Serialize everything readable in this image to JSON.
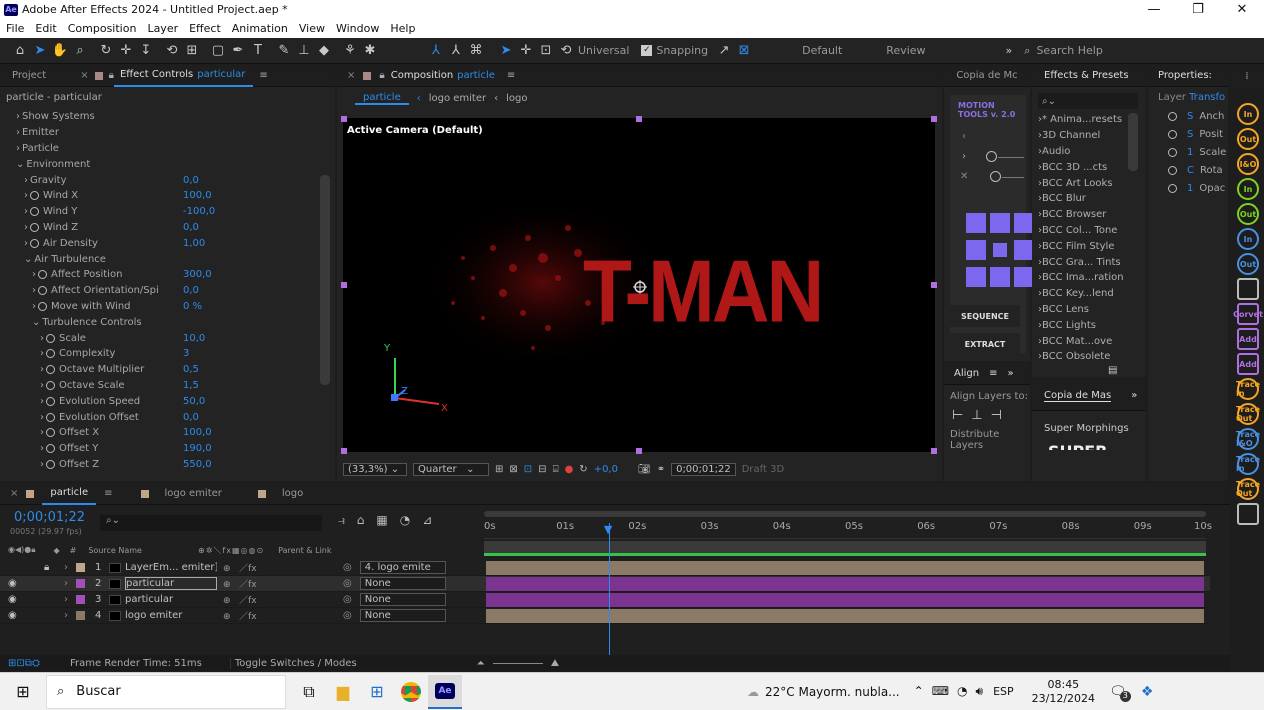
{
  "window": {
    "title": "Adobe After Effects 2024 - Untitled Project.aep *",
    "app_badge": "Ae",
    "controls": [
      "—",
      "❐",
      "✕"
    ]
  },
  "menu": [
    "File",
    "Edit",
    "Composition",
    "Layer",
    "Effect",
    "Animation",
    "View",
    "Window",
    "Help"
  ],
  "toolbar": {
    "universal_label": "Universal",
    "snapping_label": "Snapping",
    "workspaces": [
      "Default",
      "Review"
    ],
    "search_placeholder": "Search Help"
  },
  "left_panel": {
    "tabs": {
      "project": "Project",
      "effect_controls": "Effect Controls",
      "effect_controls_layer": "particular"
    },
    "layer_header": "particle - particular",
    "properties": [
      {
        "label": "Show Systems",
        "indent": 1,
        "type": "collapsed"
      },
      {
        "label": "Emitter",
        "indent": 1,
        "type": "collapsed"
      },
      {
        "label": "Particle",
        "indent": 1,
        "type": "collapsed"
      },
      {
        "label": "Environment",
        "indent": 1,
        "type": "expanded"
      },
      {
        "label": "Gravity",
        "indent": 2,
        "type": "collapsed",
        "value": "0,0"
      },
      {
        "label": "Wind X",
        "indent": 2,
        "type": "stopwatch",
        "value": "100,0"
      },
      {
        "label": "Wind Y",
        "indent": 2,
        "type": "stopwatch",
        "value": "-100,0"
      },
      {
        "label": "Wind Z",
        "indent": 2,
        "type": "stopwatch",
        "value": "0,0"
      },
      {
        "label": "Air Density",
        "indent": 2,
        "type": "stopwatch",
        "value": "1,00"
      },
      {
        "label": "Air Turbulence",
        "indent": 2,
        "type": "expanded"
      },
      {
        "label": "Affect Position",
        "indent": 3,
        "type": "stopwatch",
        "value": "300,0"
      },
      {
        "label": "Affect Orientation/Spi",
        "indent": 3,
        "type": "stopwatch",
        "value": "0,0"
      },
      {
        "label": "Move with Wind",
        "indent": 3,
        "type": "stopwatch",
        "value": "0 %"
      },
      {
        "label": "Turbulence Controls",
        "indent": 3,
        "type": "expanded"
      },
      {
        "label": "Scale",
        "indent": 4,
        "type": "stopwatch",
        "value": "10,0"
      },
      {
        "label": "Complexity",
        "indent": 4,
        "type": "stopwatch",
        "value": "3"
      },
      {
        "label": "Octave Multiplier",
        "indent": 4,
        "type": "stopwatch",
        "value": "0,5"
      },
      {
        "label": "Octave Scale",
        "indent": 4,
        "type": "stopwatch",
        "value": "1,5"
      },
      {
        "label": "Evolution Speed",
        "indent": 4,
        "type": "stopwatch",
        "value": "50,0"
      },
      {
        "label": "Evolution Offset",
        "indent": 4,
        "type": "stopwatch",
        "value": "0,0"
      },
      {
        "label": "Offset X",
        "indent": 4,
        "type": "stopwatch",
        "value": "100,0"
      },
      {
        "label": "Offset Y",
        "indent": 4,
        "type": "stopwatch",
        "value": "190,0"
      },
      {
        "label": "Offset Z",
        "indent": 4,
        "type": "stopwatch",
        "value": "550,0"
      }
    ]
  },
  "composition": {
    "tab_label": "Composition",
    "tab_comp": "particle",
    "breadcrumbs": [
      "particle",
      "logo emiter",
      "logo"
    ],
    "camera_label": "Active Camera (Default)",
    "title_text": "T-MAN",
    "axis": {
      "x": "X",
      "y": "Y",
      "z": "Z"
    },
    "bottom": {
      "zoom": "(33,3%)",
      "resolution": "Quarter",
      "exposure": "+0,0",
      "timecode": "0;00;01;22",
      "renderer": "Draft 3D"
    }
  },
  "motion_tools": {
    "tab": "Copia de Mc",
    "logo_line1": "MOTION",
    "logo_line2": "TOOLS v. 2.0",
    "sequence_label": "SEQUENCE",
    "extract_label": "EXTRACT"
  },
  "effects_presets": {
    "tab": "Effects & Presets",
    "items": [
      "* Anima...resets",
      "3D Channel",
      "Audio",
      "BCC 3D ...cts",
      "BCC Art Looks",
      "BCC Blur",
      "BCC Browser",
      "BCC Col... Tone",
      "BCC Film Style",
      "BCC Gra... Tints",
      "BCC Ima...ration",
      "BCC Key...lend",
      "BCC Lens",
      "BCC Lights",
      "BCC Mat...ove",
      "BCC Obsolete"
    ]
  },
  "properties_panel": {
    "tab": "Properties:",
    "layer_label": "Layer",
    "transform_label": "Transfo",
    "items": [
      "Anch",
      "Posit",
      "Scale",
      "Rota",
      "Opac"
    ],
    "prefixes": [
      "S",
      "S",
      "1",
      "C",
      "1"
    ]
  },
  "align_panel": {
    "tab": "Align",
    "align_to": "Align Layers to:",
    "distribute": "Distribute Layers"
  },
  "copia_mas": {
    "tab": "Copia de Mas",
    "super_morphings": "Super Morphings",
    "super_text": "SUPER"
  },
  "timeline": {
    "tabs": [
      "particle",
      "logo emiter",
      "logo"
    ],
    "timecode": "0;00;01;22",
    "timecode_sub": "00052 (29.97 fps)",
    "ruler": [
      "0s",
      "01s",
      "02s",
      "03s",
      "04s",
      "05s",
      "06s",
      "07s",
      "08s",
      "09s",
      "10s"
    ],
    "playhead_seconds": 1.73,
    "col_source": "Source Name",
    "col_parent": "Parent & Link",
    "layers": [
      {
        "num": "1",
        "name": "LayerEm... emiter]",
        "parent": "4. logo emite",
        "color": "#bfa58a",
        "bar": "#8a7a66"
      },
      {
        "num": "2",
        "name": "particular",
        "parent": "None",
        "color": "#a050b8",
        "bar": "#7b3591",
        "selected": true
      },
      {
        "num": "3",
        "name": "particular",
        "parent": "None",
        "color": "#a050b8",
        "bar": "#7b3591"
      },
      {
        "num": "4",
        "name": "logo emiter",
        "parent": "None",
        "color": "#8a7a66",
        "bar": "#8a7a66"
      }
    ],
    "render_time": "Frame Render Time:  51ms",
    "toggle_label": "Toggle Switches / Modes"
  },
  "right_strip": [
    "In",
    "Out",
    "I&O",
    "In",
    "Out",
    "In",
    "Out",
    "",
    "Corvet",
    "Add",
    "Add",
    "Trace In",
    "Trace Out",
    "Trace I&O",
    "Trace In",
    "Trace Out",
    ""
  ],
  "taskbar": {
    "search": "Buscar",
    "weather": "22°C  Mayorm. nubla...",
    "lang": "ESP",
    "time": "08:45",
    "date": "23/12/2024",
    "notif": "3"
  },
  "colors": {
    "accent": "#2d8ceb",
    "purple": "#7b3591",
    "tan": "#8a7a66",
    "red_text": "#b01818"
  }
}
